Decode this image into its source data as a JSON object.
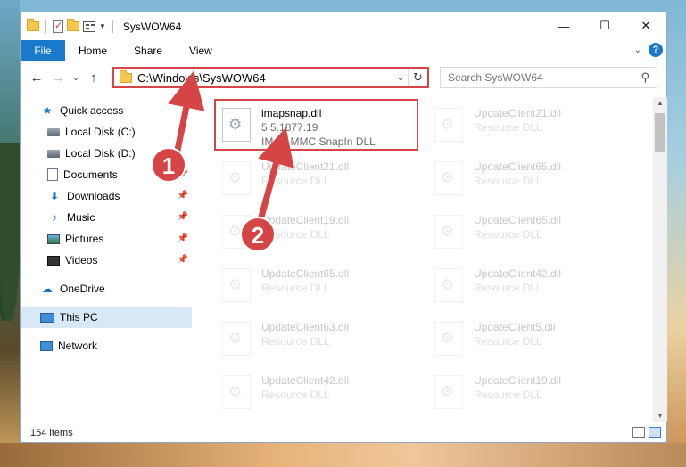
{
  "titlebar": {
    "title": "SysWOW64",
    "minimize": "—",
    "maximize": "☐",
    "close": "✕"
  },
  "ribbon": {
    "tabs": [
      "File",
      "Home",
      "Share",
      "View"
    ],
    "expand": "⌄",
    "help": "?"
  },
  "navigation": {
    "back": "←",
    "forward": "→",
    "recent": "⌄",
    "up": "↑",
    "path": "C:\\Windows\\SysWOW64",
    "dropdown": "⌄",
    "refresh": "↻",
    "search_placeholder": "Search SysWOW64",
    "search_icon": "magnifier-icon"
  },
  "sidebar": {
    "items": [
      {
        "label": "Quick access",
        "icon": "star-icon",
        "pinned": false
      },
      {
        "label": "Local Disk (C:)",
        "icon": "drive-icon",
        "pinned": false
      },
      {
        "label": "Local Disk (D:)",
        "icon": "drive-icon",
        "pinned": false
      },
      {
        "label": "Documents",
        "icon": "documents-icon",
        "pinned": true
      },
      {
        "label": "Downloads",
        "icon": "download-icon",
        "pinned": true
      },
      {
        "label": "Music",
        "icon": "music-icon",
        "pinned": true
      },
      {
        "label": "Pictures",
        "icon": "pictures-icon",
        "pinned": true
      },
      {
        "label": "Videos",
        "icon": "videos-icon",
        "pinned": true
      },
      {
        "label": "OneDrive",
        "icon": "cloud-icon",
        "pinned": false
      },
      {
        "label": "This PC",
        "icon": "pc-icon",
        "pinned": false,
        "selected": true
      },
      {
        "label": "Network",
        "icon": "network-icon",
        "pinned": false
      }
    ],
    "pin_glyph": "📌"
  },
  "files": {
    "highlighted": {
      "name": "imapsnap.dll",
      "version": "5.5.1877.19",
      "description": "IMAP MMC SnapIn DLL"
    },
    "background": [
      {
        "name": "UpdateClient21.dll",
        "type": "Resource DLL"
      },
      {
        "name": "UpdateClient21.dll",
        "type": "Resource DLL"
      },
      {
        "name": "UpdateClient65.dll",
        "type": "Resource DLL"
      },
      {
        "name": "UpdateClient19.dll",
        "type": "Resource DLL"
      },
      {
        "name": "UpdateClient65.dll",
        "type": "Resource DLL"
      },
      {
        "name": "UpdateClient65.dll",
        "type": "Resource DLL"
      },
      {
        "name": "UpdateClient42.dll",
        "type": "Resource DLL"
      },
      {
        "name": "UpdateClient63.dll",
        "type": "Resource DLL"
      },
      {
        "name": "UpdateClient5.dll",
        "type": "Resource DLL"
      },
      {
        "name": "UpdateClient42.dll",
        "type": "Resource DLL"
      },
      {
        "name": "UpdateClient19.dll",
        "type": "Resource DLL"
      }
    ]
  },
  "statusbar": {
    "item_count": "154 items"
  },
  "annotations": {
    "step1": "1",
    "step2": "2",
    "accent_color": "#d64545"
  }
}
